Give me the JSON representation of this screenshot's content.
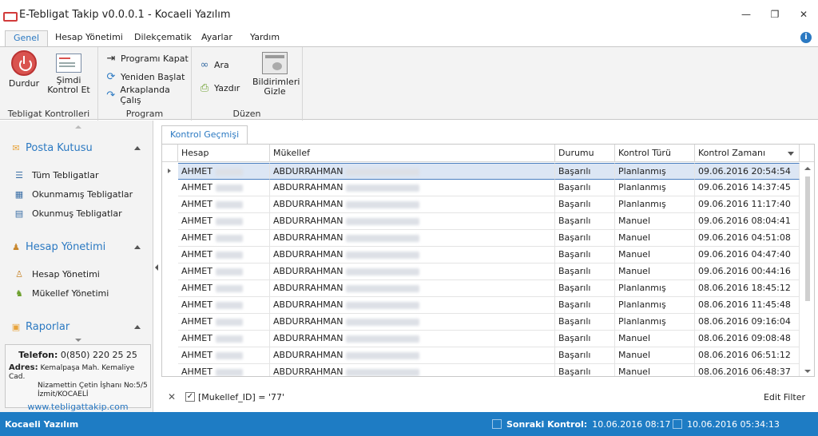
{
  "window": {
    "title": "E-Tebligat Takip v0.0.0.1 - Kocaeli Yazılım",
    "minimize": "—",
    "maximize": "❐",
    "close": "✕"
  },
  "menu_tabs": [
    "Genel",
    "Hesap Yönetimi",
    "Dilekçematik",
    "Ayarlar",
    "Yardım"
  ],
  "ribbon": {
    "groups": [
      {
        "label": "Tebligat Kontrolleri"
      },
      {
        "label": "Program"
      },
      {
        "label": "Düzen"
      }
    ],
    "durdur": "Durdur",
    "simdi_kontrol": "Şimdi\nKontrol Et",
    "programi_kapat": "Programı Kapat",
    "yeniden_baslat": "Yeniden Başlat",
    "arkaplanda_calis": "Arkaplanda Çalış",
    "ara": "Ara",
    "yazdir": "Yazdır",
    "bildirimleri_gizle": "Bildirimleri\nGizle"
  },
  "sidebar": {
    "sections": [
      {
        "title": "Posta Kutusu",
        "icon": "envelope-icon",
        "items": [
          {
            "label": "Tüm Tebligatlar",
            "icon": "list-icon"
          },
          {
            "label": "Okunmamış Tebligatlar",
            "icon": "unread-mail-icon"
          },
          {
            "label": "Okunmuş Tebligatlar",
            "icon": "read-mail-icon"
          }
        ]
      },
      {
        "title": "Hesap Yönetimi",
        "icon": "users-icon",
        "items": [
          {
            "label": "Hesap Yönetimi",
            "icon": "user-icon"
          },
          {
            "label": "Mükellef Yönetimi",
            "icon": "group-icon"
          }
        ]
      },
      {
        "title": "Raporlar",
        "icon": "report-icon",
        "items": []
      }
    ],
    "contact": {
      "phone_label": "Telefon:",
      "phone": "0(850) 220 25 25",
      "address_label": "Adres:",
      "address_line1": "Kemalpaşa Mah. Kemaliye Cad.",
      "address_line2": "Nizamettin Çetin İşhanı No:5/5",
      "address_line3": "İzmit/KOCAELİ",
      "url": "www.tebligattakip.com"
    }
  },
  "content": {
    "tab": "Kontrol Geçmişi",
    "columns": [
      "Hesap",
      "Mükellef",
      "Durumu",
      "Kontrol Türü",
      "Kontrol Zamanı"
    ],
    "rows": [
      [
        "AHMET",
        "ABDURRAHMAN",
        "Başarılı",
        "Planlanmış",
        "09.06.2016 20:54:54"
      ],
      [
        "AHMET",
        "ABDURRAHMAN",
        "Başarılı",
        "Planlanmış",
        "09.06.2016 14:37:45"
      ],
      [
        "AHMET",
        "ABDURRAHMAN",
        "Başarılı",
        "Planlanmış",
        "09.06.2016 11:17:40"
      ],
      [
        "AHMET",
        "ABDURRAHMAN",
        "Başarılı",
        "Manuel",
        "09.06.2016 08:04:41"
      ],
      [
        "AHMET",
        "ABDURRAHMAN",
        "Başarılı",
        "Manuel",
        "09.06.2016 04:51:08"
      ],
      [
        "AHMET",
        "ABDURRAHMAN",
        "Başarılı",
        "Manuel",
        "09.06.2016 04:47:40"
      ],
      [
        "AHMET",
        "ABDURRAHMAN",
        "Başarılı",
        "Manuel",
        "09.06.2016 00:44:16"
      ],
      [
        "AHMET",
        "ABDURRAHMAN",
        "Başarılı",
        "Planlanmış",
        "08.06.2016 18:45:12"
      ],
      [
        "AHMET",
        "ABDURRAHMAN",
        "Başarılı",
        "Planlanmış",
        "08.06.2016 11:45:48"
      ],
      [
        "AHMET",
        "ABDURRAHMAN",
        "Başarılı",
        "Planlanmış",
        "08.06.2016 09:16:04"
      ],
      [
        "AHMET",
        "ABDURRAHMAN",
        "Başarılı",
        "Manuel",
        "08.06.2016 09:08:48"
      ],
      [
        "AHMET",
        "ABDURRAHMAN",
        "Başarılı",
        "Manuel",
        "08.06.2016 06:51:12"
      ],
      [
        "AHMET",
        "ABDURRAHMAN",
        "Başarılı",
        "Manuel",
        "08.06.2016 06:48:37"
      ]
    ],
    "filter": {
      "close": "✕",
      "checked": "✓",
      "text": "[Mukellef_ID] = '77'",
      "edit": "Edit Filter"
    }
  },
  "status": {
    "company": "Kocaeli Yazılım",
    "next_label": "Sonraki Kontrol:",
    "next_value": "10.06.2016 08:17",
    "now_value": "10.06.2016 05:34:13"
  },
  "colors": {
    "accent": "#2b79c2",
    "statusbar": "#1e7cc4",
    "selected_row": "#dce6f4"
  }
}
